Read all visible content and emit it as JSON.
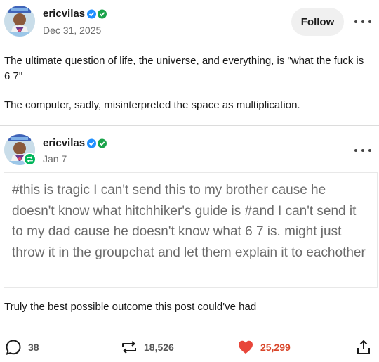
{
  "post": {
    "username": "ericvilas",
    "date": "Dec 31, 2025",
    "follow_label": "Follow",
    "paragraph_1": "The ultimate question of life, the universe, and everything, is \"what the fuck is 6 7\"",
    "paragraph_2": "The computer, sadly, misinterpreted the space as multiplication."
  },
  "reblog": {
    "username": "ericvilas",
    "date": "Jan 7",
    "tags": "#this is tragic I can't send this to my brother cause he doesn't know what hitchhiker's guide is #and I can't send it to my dad cause he doesn't know what 6 7 is. might just throw it in the groupchat and let them explain it to eachother",
    "comment": "Truly the best possible outcome this post could've had"
  },
  "footer": {
    "replies": "38",
    "reblogs": "18,526",
    "likes": "25,299"
  },
  "colors": {
    "verified_blue": "#1f8fff",
    "verified_green": "#1aa34a",
    "reblog_green": "#00b55b",
    "like_red": "#e8463a"
  },
  "icons": [
    "checkmark-badge-icon",
    "more-options-icon",
    "reblog-icon",
    "reply-icon",
    "like-heart-icon",
    "share-icon"
  ]
}
